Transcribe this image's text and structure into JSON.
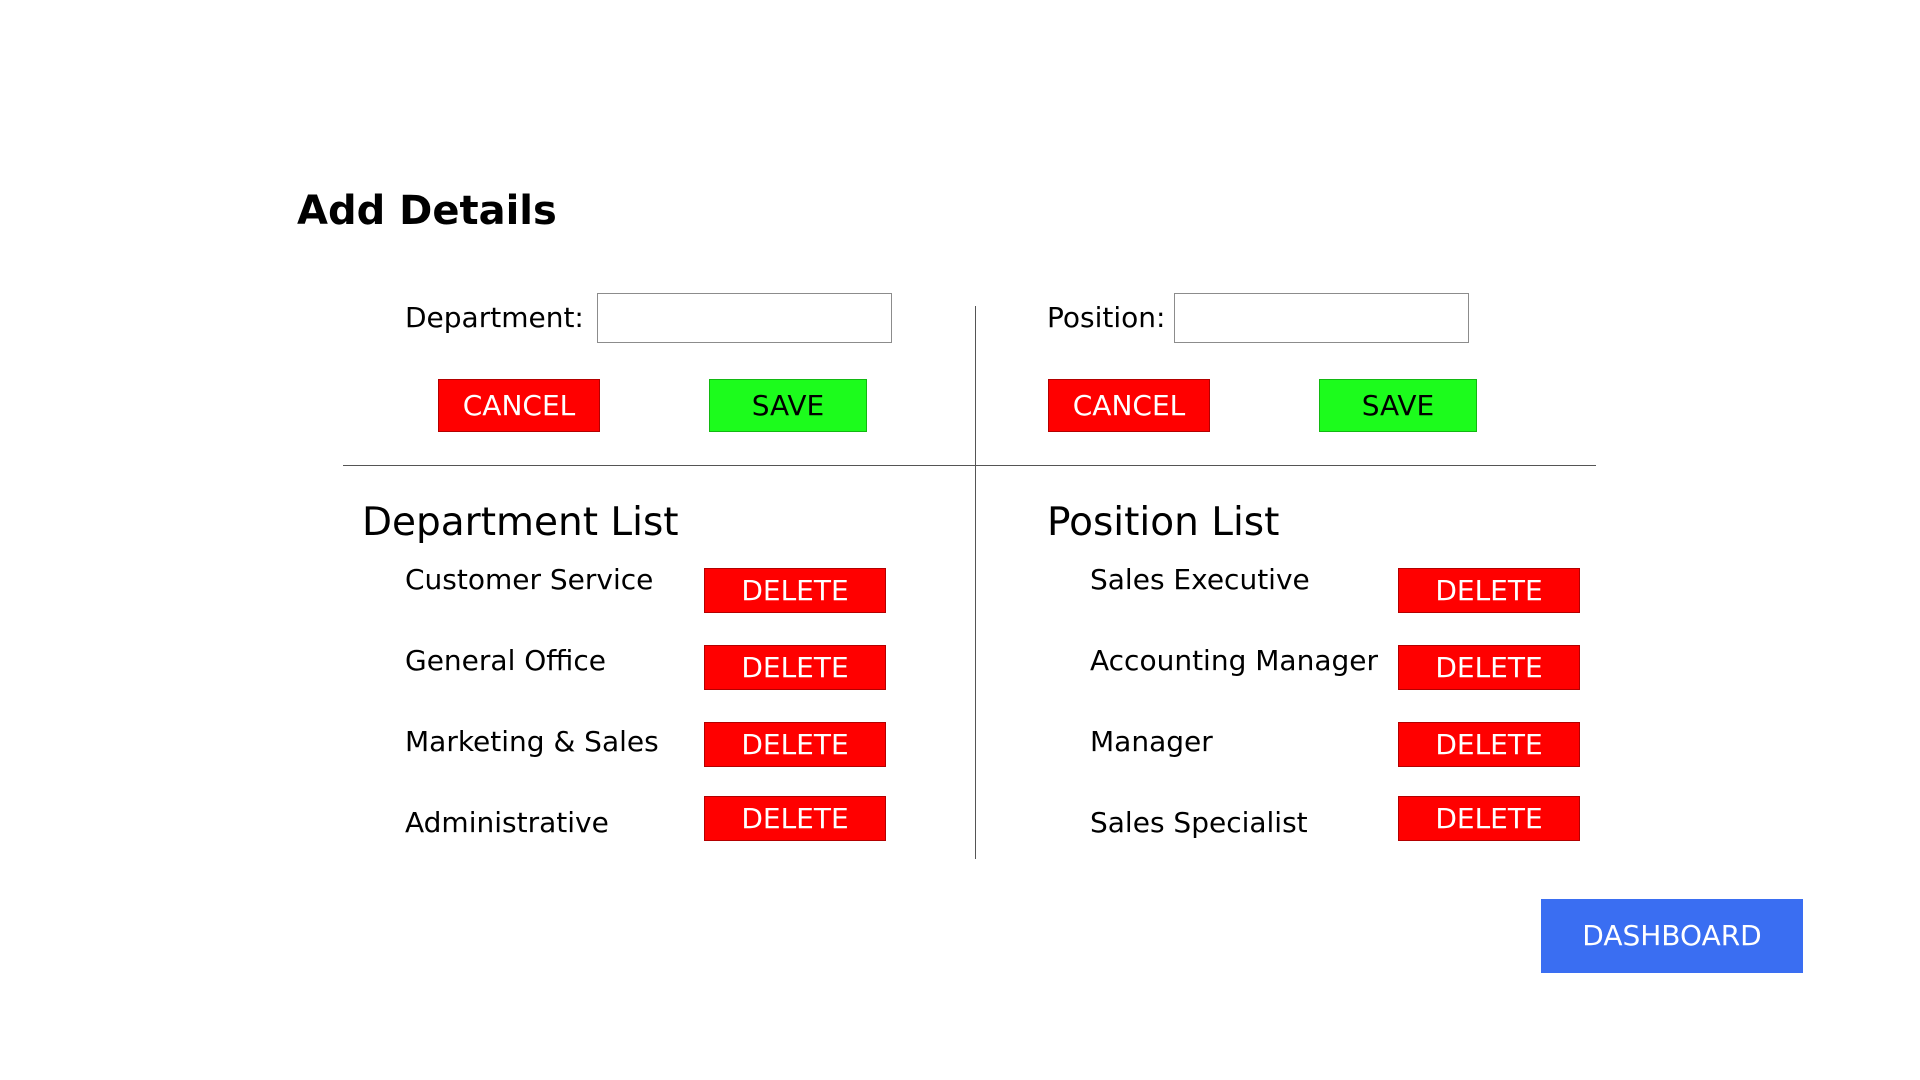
{
  "page": {
    "title": "Add Details"
  },
  "department_form": {
    "label": "Department:",
    "value": "",
    "placeholder": "",
    "cancel_label": "CANCEL",
    "save_label": "SAVE"
  },
  "position_form": {
    "label": "Position:",
    "value": "",
    "placeholder": "",
    "cancel_label": "CANCEL",
    "save_label": "SAVE"
  },
  "department_list": {
    "title": "Department List",
    "items": [
      {
        "name": "Customer Service",
        "delete_label": "DELETE"
      },
      {
        "name": "General Office",
        "delete_label": "DELETE"
      },
      {
        "name": "Marketing & Sales",
        "delete_label": "DELETE"
      },
      {
        "name": "Administrative",
        "delete_label": "DELETE"
      }
    ]
  },
  "position_list": {
    "title": "Position List",
    "items": [
      {
        "name": "Sales Executive",
        "delete_label": "DELETE"
      },
      {
        "name": "Accounting Manager",
        "delete_label": "DELETE"
      },
      {
        "name": "Manager",
        "delete_label": "DELETE"
      },
      {
        "name": "Sales Specialist",
        "delete_label": "DELETE"
      }
    ]
  },
  "footer": {
    "dashboard_label": "DASHBOARD"
  },
  "colors": {
    "cancel": "#ff0000",
    "save": "#1cfc1c",
    "delete": "#ff0000",
    "dashboard": "#3a6ef2",
    "divider": "#555555"
  }
}
